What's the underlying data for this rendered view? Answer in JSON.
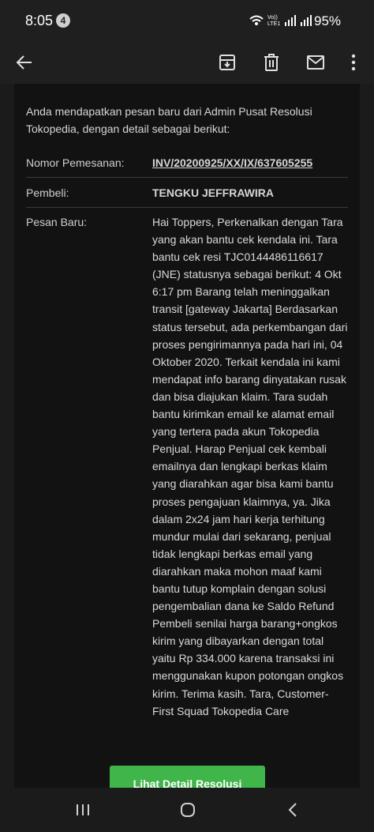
{
  "status_bar": {
    "time": "8:05",
    "notification_count": "4",
    "battery": "95%",
    "network_label": "Vo)) LTE1"
  },
  "app_bar": {
    "icons": [
      "back-arrow-icon",
      "archive-icon",
      "delete-icon",
      "mark-unread-icon",
      "more-vert-icon"
    ]
  },
  "email": {
    "intro": "Anda mendapatkan pesan baru dari Admin Pusat Resolusi Tokopedia, dengan detail sebagai berikut:",
    "order_label": "Nomor Pemesanan:",
    "order_number": "INV/20200925/XX/IX/637605255",
    "buyer_label": "Pembeli:",
    "buyer_name": "TENGKU JEFFRAWIRA",
    "message_label": "Pesan Baru:",
    "message_body": "Hai Toppers, Perkenalkan dengan Tara yang akan bantu cek kendala ini. Tara bantu cek resi TJC0144486116617 (JNE) statusnya sebagai berikut: 4 Okt 6:17 pm Barang telah meninggalkan transit [gateway Jakarta] Berdasarkan status tersebut, ada perkembangan dari proses pengirimannya pada hari ini, 04 Oktober 2020. Terkait kendala ini kami mendapat info barang dinyatakan rusak dan bisa diajukan klaim. Tara sudah bantu kirimkan email ke alamat email yang tertera pada akun Tokopedia Penjual. Harap Penjual cek kembali emailnya dan lengkapi berkas klaim yang diarahkan agar bisa kami bantu proses pengajuan klaimnya, ya. Jika dalam 2x24 jam hari kerja terhitung mundur mulai dari sekarang, penjual tidak lengkapi berkas email yang diarahkan maka mohon maaf kami bantu tutup komplain dengan solusi pengembalian dana ke Saldo Refund Pembeli senilai harga barang+ongkos kirim yang dibayarkan dengan total yaitu Rp 334.000 karena transaksi ini menggunakan kupon potongan ongkos kirim. Terima kasih. Tara, Customer-First Squad Tokopedia Care",
    "cta_label": "Lihat Detail Resolusi"
  },
  "nav_bar": {
    "icons": [
      "recent-apps-icon",
      "home-icon",
      "back-icon"
    ]
  },
  "colors": {
    "link_green": "#1fae3c",
    "button_green": "#3fb54a",
    "background": "#121212"
  }
}
